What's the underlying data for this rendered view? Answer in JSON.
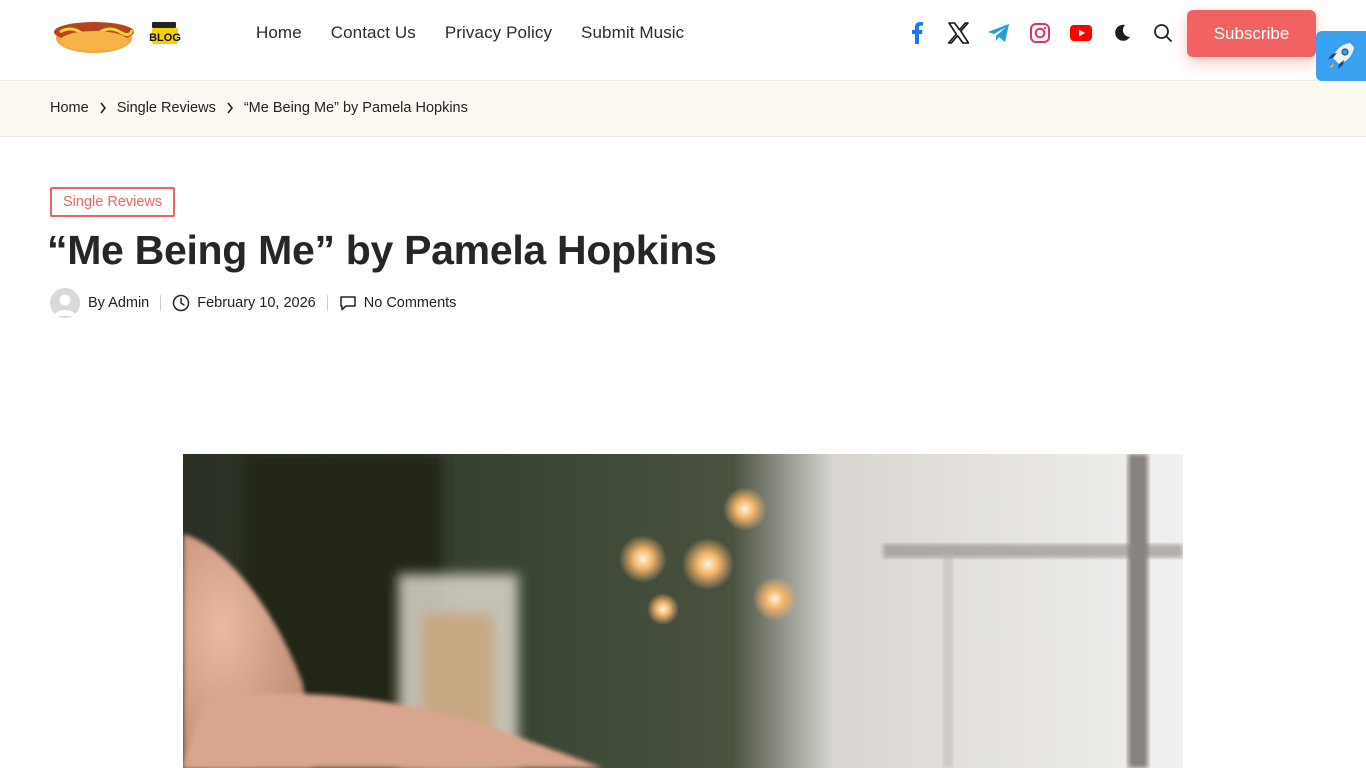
{
  "header": {
    "logo_text": "BLOG",
    "nav": [
      "Home",
      "Contact Us",
      "Privacy Policy",
      "Submit Music"
    ],
    "social_icons": [
      "facebook-icon",
      "x-icon",
      "telegram-icon",
      "instagram-icon",
      "youtube-icon",
      "dark-mode-icon",
      "search-icon"
    ],
    "subscribe_label": "Subscribe"
  },
  "breadcrumb": {
    "items": [
      "Home",
      "Single Reviews",
      "“Me Being Me” by Pamela Hopkins"
    ]
  },
  "post": {
    "category": "Single Reviews",
    "title": "“Me Being Me” by Pamela Hopkins",
    "author": "By Admin",
    "date": "February 10, 2026",
    "comments": "No Comments"
  },
  "colors": {
    "accent": "#f36262",
    "crumb_bg": "#fdf8f2",
    "facebook": "#1877f2",
    "telegram": "#229ed9",
    "instagram": "#e1306c",
    "youtube": "#ff0000"
  }
}
